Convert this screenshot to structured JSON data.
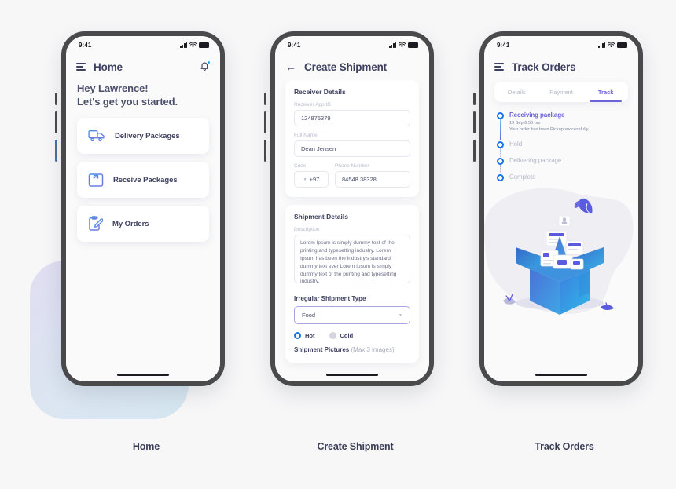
{
  "colors": {
    "page_background": "#f7f7f8",
    "phone_bezel": "#4a4a4d",
    "heading_text": "#3e4160",
    "muted_text": "#b3b6c7",
    "accent_blue": "#1a73e8",
    "accent_purple": "#6c63d9",
    "badge_blue": "#29a9f2",
    "deco_gradient_from": "#dcd9f0",
    "deco_gradient_to": "#cfe3ef"
  },
  "status_bar": {
    "time": "9:41",
    "signal_icon": "signal-bars-icon",
    "wifi_icon": "wifi-icon",
    "battery_icon": "battery-icon"
  },
  "screens": [
    {
      "caption": "Home",
      "header": {
        "menu_icon": "hamburger-menu-icon",
        "title": "Home",
        "notification_icon": "bell-icon",
        "has_notification_badge": true
      },
      "greeting_line1": "Hey Lawrence!",
      "greeting_line2": "Let's get you started.",
      "menu_items": [
        {
          "label": "Delivery Packages",
          "icon": "truck-icon"
        },
        {
          "label": "Receive Packages",
          "icon": "package-box-icon"
        },
        {
          "label": "My Orders",
          "icon": "clipboard-edit-icon"
        }
      ]
    },
    {
      "caption": "Create Shipment",
      "header": {
        "back_icon": "back-arrow-icon",
        "title": "Create Shipment"
      },
      "receiver_section": {
        "title": "Receiver Details",
        "fields": [
          {
            "label": "Receiver App ID",
            "value": "124875379",
            "name": "receiver-app-id"
          },
          {
            "label": "Full Name",
            "value": "Dean Jensen",
            "name": "full-name"
          }
        ],
        "code_label": "Code",
        "code_value": "+97",
        "phone_label": "Phone Number",
        "phone_value": "84548 38328"
      },
      "shipment_section": {
        "title": "Shipment Details",
        "description_label": "Description",
        "description_value": "Lorem Ipsum is simply dummy text of the printing and typesetting industry. Lorem Ipsum has been the industry's standard dummy text ever Lorem Ipsum is simply dummy text of the printing and typesetting industry.",
        "type_label": "Irregular Shipment Type",
        "type_value": "Food",
        "type_caret_icon": "chevron-down-icon",
        "temperature_options": [
          {
            "label": "Hot",
            "selected": true
          },
          {
            "label": "Cold",
            "selected": false
          }
        ],
        "pictures_label": "Shipment Pictures",
        "pictures_hint": "(Max 3 images)"
      }
    },
    {
      "caption": "Track Orders",
      "header": {
        "menu_icon": "hamburger-menu-icon",
        "title": "Track Orders"
      },
      "tabs": [
        {
          "label": "Details",
          "active": false
        },
        {
          "label": "Payment",
          "active": false
        },
        {
          "label": "Track",
          "active": true
        }
      ],
      "timeline": [
        {
          "title": "Receiving package",
          "active": true,
          "time": "19 Sep 6:56 pm",
          "note": "Your order has been Pickup successfully"
        },
        {
          "title": "Hold",
          "active": false,
          "time": "",
          "note": ""
        },
        {
          "title": "Delivering package",
          "active": false,
          "time": "",
          "note": ""
        },
        {
          "title": "Complete",
          "active": false,
          "time": "",
          "note": ""
        }
      ],
      "illustration": "open-package-box-illustration"
    }
  ]
}
